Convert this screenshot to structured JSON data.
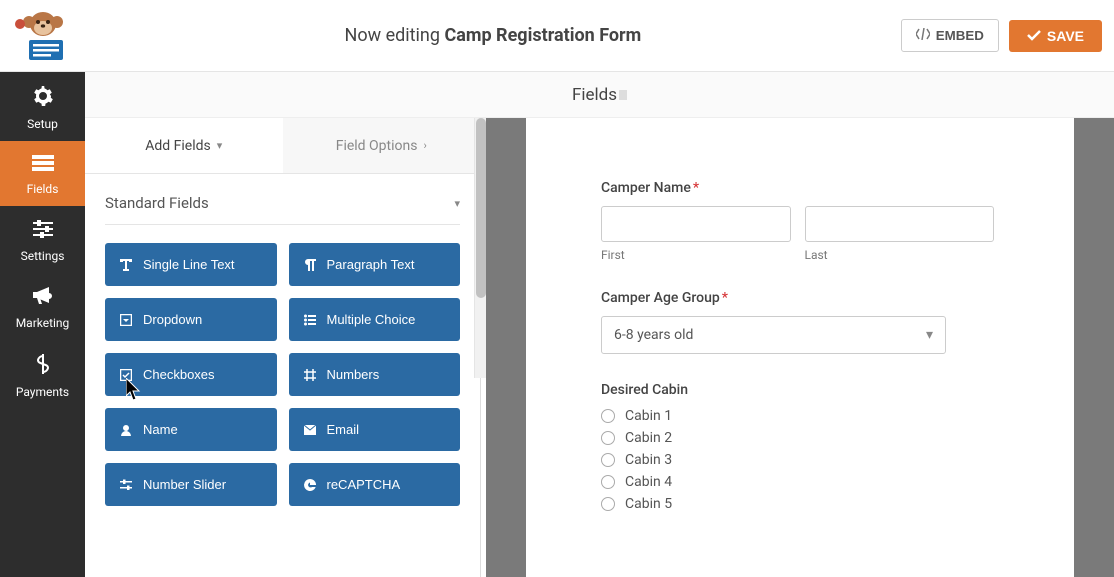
{
  "header": {
    "editing_prefix": "Now editing ",
    "form_name": "Camp Registration Form",
    "embed_label": "EMBED",
    "save_label": "SAVE"
  },
  "sidenav": {
    "items": [
      {
        "key": "setup",
        "label": "Setup"
      },
      {
        "key": "fields",
        "label": "Fields"
      },
      {
        "key": "settings",
        "label": "Settings"
      },
      {
        "key": "marketing",
        "label": "Marketing"
      },
      {
        "key": "payments",
        "label": "Payments"
      }
    ],
    "active": "fields"
  },
  "fields_strip": {
    "label": "Fields"
  },
  "panel": {
    "tabs": {
      "add": "Add Fields",
      "options": "Field Options"
    },
    "section_title": "Standard Fields",
    "fields": [
      {
        "label": "Single Line Text"
      },
      {
        "label": "Paragraph Text"
      },
      {
        "label": "Dropdown"
      },
      {
        "label": "Multiple Choice"
      },
      {
        "label": "Checkboxes"
      },
      {
        "label": "Numbers"
      },
      {
        "label": "Name"
      },
      {
        "label": "Email"
      },
      {
        "label": "Number Slider"
      },
      {
        "label": "reCAPTCHA"
      }
    ]
  },
  "preview": {
    "camper_name_label": "Camper Name",
    "first_sub": "First",
    "last_sub": "Last",
    "age_group_label": "Camper Age Group",
    "age_group_value": "6-8 years old",
    "cabin_label": "Desired Cabin",
    "cabins": [
      "Cabin 1",
      "Cabin 2",
      "Cabin 3",
      "Cabin 4",
      "Cabin 5"
    ]
  }
}
